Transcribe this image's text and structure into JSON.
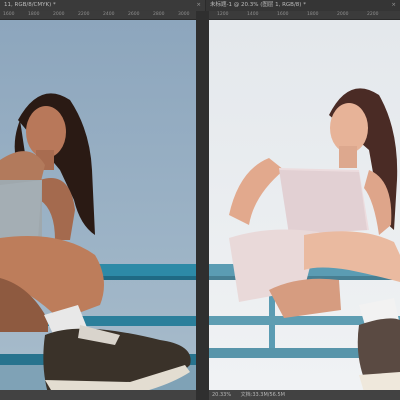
{
  "tabs": [
    {
      "label": "11, RGB/8/CMYK) *",
      "close": "×"
    },
    {
      "label": "未标题-1 @ 20.3% (图层 1, RGB/8) *",
      "close": "×"
    }
  ],
  "ruler_left": [
    "1600",
    "1800",
    "2000",
    "2200",
    "2400",
    "2600",
    "2800",
    "3000"
  ],
  "ruler_right": [
    "1200",
    "1400",
    "1600",
    "1800",
    "2000",
    "2200"
  ],
  "status_left": "",
  "status_right": {
    "zoom": "20.33%",
    "doc": "文档:33.3M/56.5M"
  },
  "images": [
    {
      "name": "original-photo"
    },
    {
      "name": "edited-photo"
    }
  ]
}
